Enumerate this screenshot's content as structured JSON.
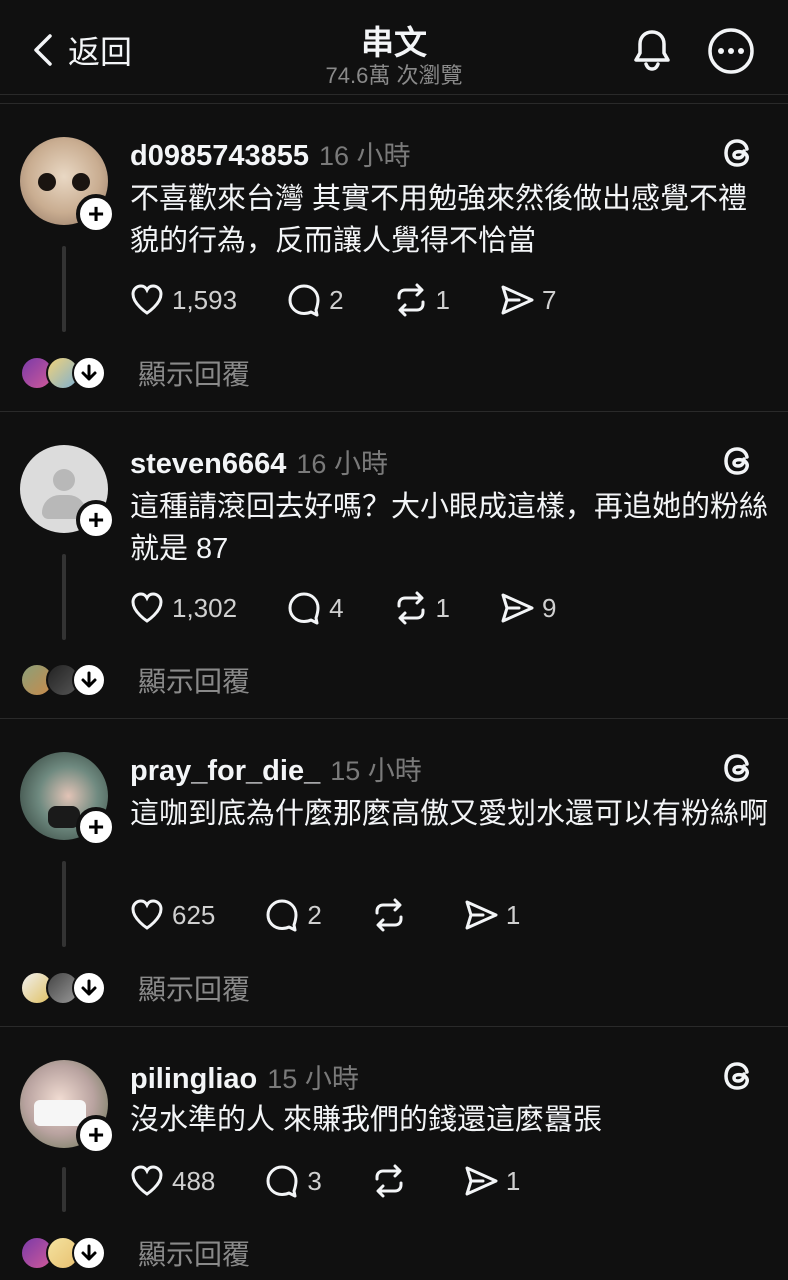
{
  "header": {
    "back_label": "返回",
    "title": "串文",
    "views": "74.6萬 次瀏覽"
  },
  "colors": {
    "background": "#101010",
    "text": "#f3f5f7",
    "muted": "#7a7a7a"
  },
  "comments": [
    {
      "username": "d0985743855",
      "time": "16 小時",
      "text": "不喜歡來台灣 其實不用勉強來然後做出感覺不禮貌的行為，反而讓人覺得不恰當",
      "likes": "1,593",
      "replies": "2",
      "reposts": "1",
      "shares": "7",
      "show_replies": "顯示回覆"
    },
    {
      "username": "steven6664",
      "time": "16 小時",
      "text": "這種請滾回去好嗎？大小眼成這樣，再追她的粉絲就是 87",
      "likes": "1,302",
      "replies": "4",
      "reposts": "1",
      "shares": "9",
      "show_replies": "顯示回覆"
    },
    {
      "username": "pray_for_die_",
      "time": "15 小時",
      "text": "這咖到底為什麼那麼高傲又愛划水還可以有粉絲啊",
      "likes": "625",
      "replies": "2",
      "reposts": "",
      "shares": "1",
      "show_replies": "顯示回覆"
    },
    {
      "username": "pilingliao",
      "time": "15 小時",
      "text": "沒水準的人  來賺我們的錢還這麼囂張",
      "likes": "488",
      "replies": "3",
      "reposts": "",
      "shares": "1",
      "show_replies": "顯示回覆"
    }
  ]
}
